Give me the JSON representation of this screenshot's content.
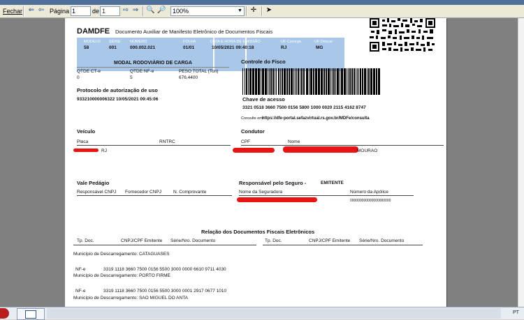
{
  "toolbar": {
    "close_label": "Fechar",
    "page_label": "Página",
    "page_value": "1",
    "of_label": "de",
    "page_total": "1",
    "zoom_value": "100%"
  },
  "doc": {
    "title": "DAMDFE",
    "subtitle": "Documento Auxiliar de Manifesto Eletrônico de Documentos Fiscais",
    "header_fields": [
      {
        "label": "MODELO",
        "value": "58"
      },
      {
        "label": "SÉRIE",
        "value": "001"
      },
      {
        "label": "NÚMERO",
        "value": "000.002.021"
      },
      {
        "label": "FOLHA",
        "value": "01/01"
      },
      {
        "label": "DATA E HORA DE EMISSÃO",
        "value": "10/05/2021 09:40:18"
      },
      {
        "label": "UF Carrega",
        "value": "RJ"
      },
      {
        "label": "UF Descar",
        "value": "MG"
      }
    ],
    "modal_title": "MODAL RODOVIÁRIO DE CARGA",
    "qtd_cte_label": "QTDE CT-e",
    "qtd_cte_value": "0",
    "qtd_nfe_label": "QTDE NF-e",
    "qtd_nfe_value": "5",
    "peso_label": "PESO TOTAL (Ton)",
    "peso_value": "676,4400",
    "protocolo_label": "Protocolo de autorização de uso",
    "protocolo_value": "933210000006322  10/05/2021 09:45:06",
    "controle_label": "Controle do Fisco",
    "chave_label": "Chave de acesso",
    "chave_value": "3321 0518 3660 7500 0156 5800 1000 0020 2115 4162 8747",
    "consulta_label": "Consulte em:",
    "consulta_url": "https://dfe-portal.sefazvirtual.rs.gov.br/MDFe/consulta",
    "veiculo_title": "Veículo",
    "placa_label": "Placa",
    "rntrc_label": "RNTRC",
    "placa_uf": "RJ",
    "condutor_title": "Condutor",
    "cpf_label": "CPF",
    "nome_label": "Nome",
    "condutor_nome_visible": "MOURAO",
    "vale_title": "Vale Pedágio",
    "resp_cnpj_label": "Responsável CNPJ",
    "fornecedor_label": "Fornecedor CNPJ",
    "n_comprovante_label": "N. Comprovante",
    "seguro_title": "Responsável pelo Seguro -",
    "seguro_value": "EMITENTE",
    "seguradora_label": "Nome da Seguradora",
    "apolice_label": "Número da Apólice",
    "apolice_value": "000000000000000000000",
    "relacao_title": "Relação dos Documentos Fiscais Eletrônicos",
    "col_tp_doc": "Tp. Doc.",
    "col_cnpj": "CNPJ/CPF Emitente",
    "col_serie": "Série/Nro. Documento",
    "municipio_label": "Município de Descarregamento:",
    "rows": [
      {
        "type": "muni",
        "city": "CATAGUASES"
      },
      {
        "type": "nfe",
        "doc": "NF-e",
        "key": "3319 1118 3660 7500 0156 5500 3000 0000 6610 9711 4030"
      },
      {
        "type": "muni",
        "city": "PORTO FIRME"
      },
      {
        "type": "nfe",
        "doc": "NF-e",
        "key": "3319 1118 3660 7500 0156 5500 3000 0001 2917 0677 1010"
      },
      {
        "type": "muni",
        "city": "SAO MIGUEL DO ANTA"
      }
    ]
  },
  "taskbar": {
    "lang": "PT"
  }
}
